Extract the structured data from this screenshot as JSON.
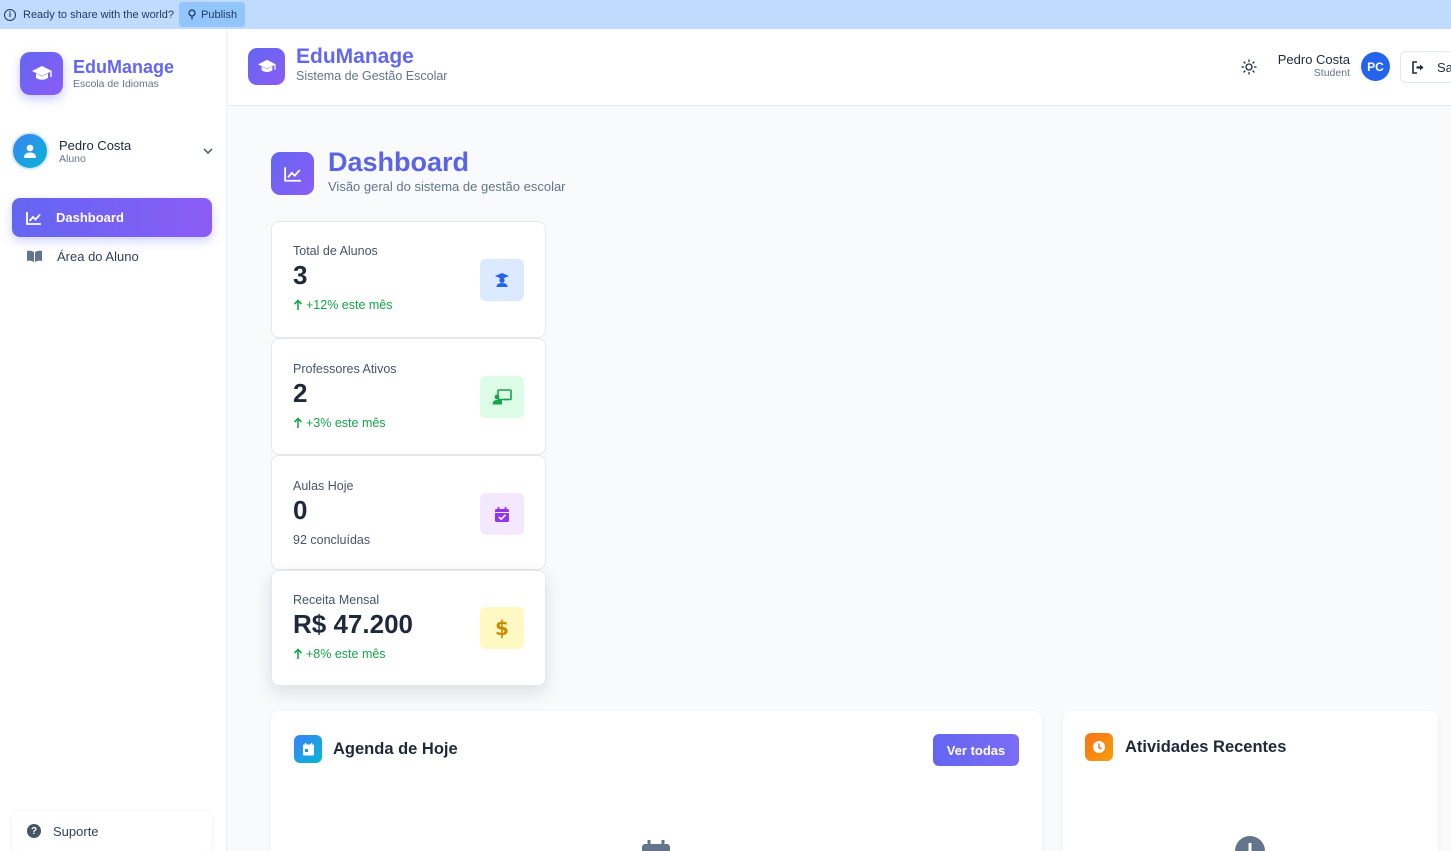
{
  "banner": {
    "message": "Ready to share with the world?",
    "publish_label": "Publish"
  },
  "sidebar": {
    "brand_title": "EduManage",
    "brand_subtitle": "Escola de Idiomas",
    "user_name": "Pedro Costa",
    "user_role": "Aluno",
    "nav": [
      {
        "label": "Dashboard",
        "icon": "chart-line-icon",
        "active": true
      },
      {
        "label": "Área do Aluno",
        "icon": "book-open-icon",
        "active": false
      }
    ],
    "support_label": "Suporte"
  },
  "header": {
    "title": "EduManage",
    "subtitle": "Sistema de Gestão Escolar",
    "user_name": "Pedro Costa",
    "user_role": "Student",
    "avatar_initials": "PC",
    "logout_label": "Sa"
  },
  "page": {
    "title": "Dashboard",
    "subtitle": "Visão geral do sistema de gestão escolar"
  },
  "stats": [
    {
      "label": "Total de Alunos",
      "value": "3",
      "trend": "+12% este mês",
      "trend_up": true,
      "icon": "graduate-icon",
      "color": "#2563eb",
      "bg": "#dbeafe"
    },
    {
      "label": "Professores Ativos",
      "value": "2",
      "trend": "+3% este mês",
      "trend_up": true,
      "icon": "teacher-icon",
      "color": "#16a34a",
      "bg": "#dcfce7"
    },
    {
      "label": "Aulas Hoje",
      "value": "0",
      "trend": "92 concluídas",
      "trend_up": false,
      "icon": "calendar-check-icon",
      "color": "#9333ea",
      "bg": "#f3e8ff"
    },
    {
      "label": "Receita Mensal",
      "value": "R$ 47.200",
      "trend": "+8% este mês",
      "trend_up": true,
      "icon": "dollar-icon",
      "color": "#ca8a04",
      "bg": "#fef9c3"
    }
  ],
  "agenda": {
    "title": "Agenda de Hoje",
    "button_label": "Ver todas"
  },
  "activities": {
    "title": "Atividades Recentes"
  }
}
